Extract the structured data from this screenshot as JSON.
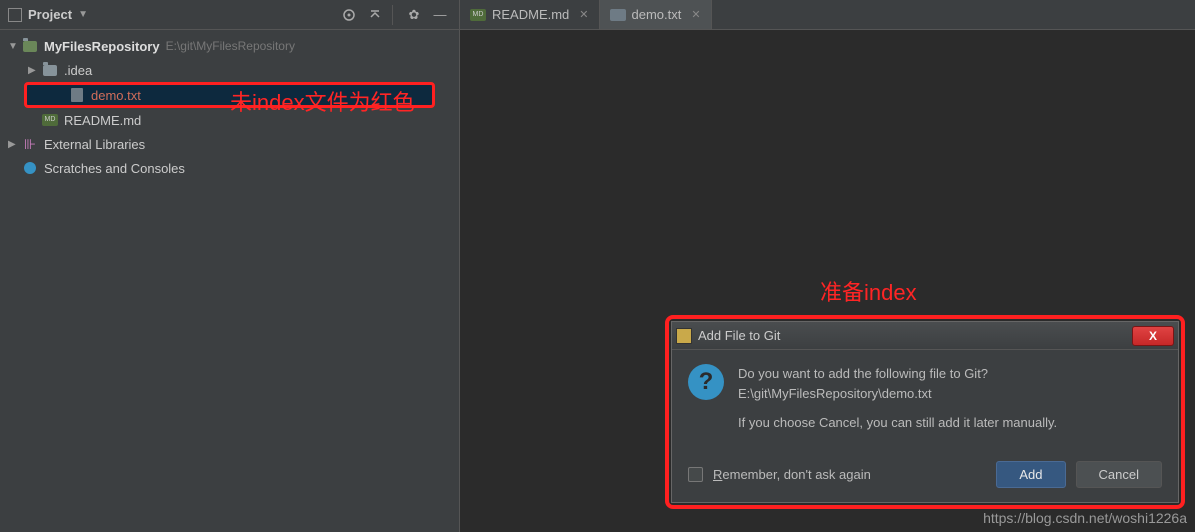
{
  "sidebar": {
    "title": "Project",
    "root": {
      "name": "MyFilesRepository",
      "path": "E:\\git\\MyFilesRepository",
      "children": [
        {
          "name": ".idea",
          "type": "folder"
        },
        {
          "name": "demo.txt",
          "type": "file",
          "vcs_status": "unversioned"
        },
        {
          "name": "README.md",
          "type": "md"
        }
      ]
    },
    "external_libs": "External Libraries",
    "scratches": "Scratches and Consoles"
  },
  "tabs": [
    {
      "label": "README.md",
      "type": "md",
      "active": false
    },
    {
      "label": "demo.txt",
      "type": "file",
      "active": true
    }
  ],
  "annotations": {
    "left": "未index文件为红色",
    "right": "准备index"
  },
  "dialog": {
    "title": "Add File to Git",
    "line1": "Do you want to add the following file to Git?",
    "path": "E:\\git\\MyFilesRepository\\demo.txt",
    "line2": "If you choose Cancel, you can still add it later manually.",
    "remember_prefix": "R",
    "remember_rest": "emember, don't ask again",
    "add": "Add",
    "cancel": "Cancel"
  },
  "watermark": "https://blog.csdn.net/woshi1226a"
}
